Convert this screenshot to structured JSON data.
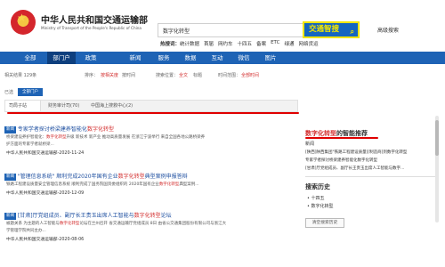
{
  "header": {
    "ministry_name": "中华人民共和国交通运输部",
    "ministry_en": "Ministry of Transport of the People's Republic of China",
    "search_value": "数字化转型",
    "search_button": "交通智搜",
    "advanced_search": "高级搜索",
    "hot_label": "热搜词：",
    "hot_words": [
      "统计数据",
      "首届",
      "网约车",
      "十四五",
      "备案",
      "ETC",
      "绿通",
      "网络货运"
    ]
  },
  "nav": {
    "items": [
      "全部",
      "部门户",
      "政策",
      "新闻",
      "服务",
      "数据",
      "互动",
      "微信",
      "图片"
    ]
  },
  "filters": {
    "result_count": "相关结果 129条",
    "sort_label": "排序：",
    "sort_relevance": "按相关度",
    "sort_time": "按时间",
    "position_label": "搜索位置：",
    "position_all": "全文",
    "position_title": "标题",
    "time_label": "时间范围：",
    "time_all": "全部时间"
  },
  "chips": {
    "label": "已选",
    "selected": "全部门户"
  },
  "tabs": {
    "items": [
      "司局子站",
      "财务审计司(70)",
      "中国海上搜救中心(2)"
    ]
  },
  "results": [
    {
      "badge": "新闻",
      "title_pre": "专家学者探讨桥梁建养智能化",
      "title_hl": "数字化转型",
      "line1_pre": "桥梁建设养护智能化：",
      "line1_hl": "数字化转型",
      "line1_post": "升级 新技术 新产业 推动高质量发展 在浙江宁波举行 来自全国各地公路桥梁养",
      "line2": "护方面的专家学者就桥梁...",
      "source": "中华人民共和国交通运输部-2020-11-24"
    },
    {
      "badge": "新闻",
      "title_pre": "\"管理信息系统\" 顺利完成2020年国有企业",
      "title_hl": "数字化转型",
      "title_post": "典型案例申报答辩",
      "line1_pre": "铁路工程建设质量安全管理信息系统 顺利完成了国务院国资委组织的 2020年国有企业",
      "line1_hl": "数字化转型",
      "line1_post": "典型案例...",
      "line2": "",
      "source": "中华人民共和国交通运输部-2020-12-09"
    },
    {
      "badge": "新闻",
      "title_pre": "[甘肃]厅党组成员、副厅长王贵玉出席人工智能与",
      "title_hl": "数字化转型",
      "title_post": "论坛",
      "line1_pre": "被题关系 为主题的人工智能与",
      "line1_hl": "数字化转型",
      "line1_post": "论坛在兰州召开 省交通运输厅党组成员 8日 由省公交通集团股份有限公司与浙江大",
      "line2": "学管理学院共同主办...",
      "source": "中华人民共和国交通运输部-2020-08-06"
    }
  ],
  "sidebar": {
    "title_hl": "数字化转型",
    "title_post": "的智能推荐",
    "sub": "新闻",
    "items": [
      "[陕西]陕西集团\"铁路工程建设质量][制造商]到数字化转型",
      "专家学者探讨桥梁建养智能化数字化转型",
      "[甘肃]厅党组成员、副厅长王贵玉出席人工智能与数字..."
    ],
    "history_title": "搜索历史",
    "history": [
      "十四五",
      "数字化转型"
    ],
    "clear_button": "清空搜索历史"
  }
}
